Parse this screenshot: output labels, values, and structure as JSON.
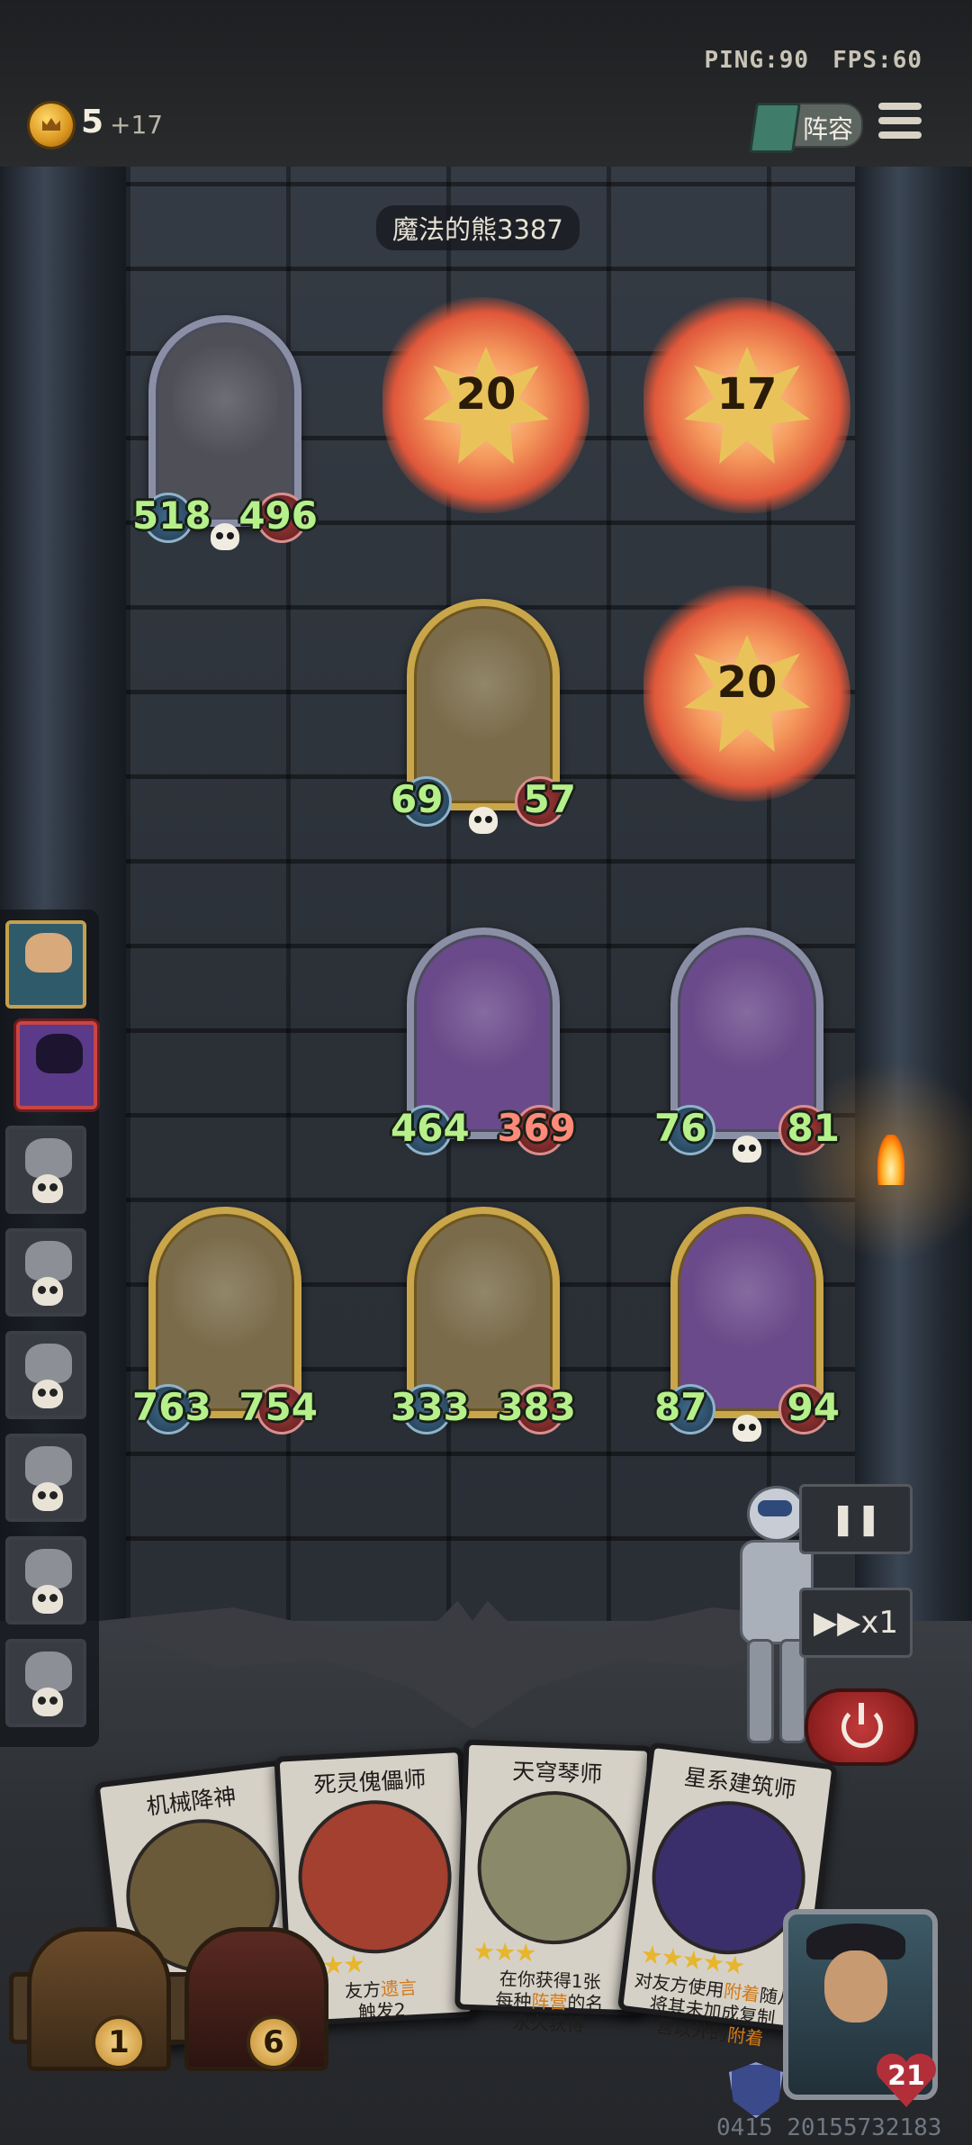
{
  "status": {
    "ping": "PING:90",
    "fps": "FPS:60"
  },
  "economy": {
    "gold": "5",
    "gold_income": "+17"
  },
  "header": {
    "lineup_label": "阵容"
  },
  "opponent": {
    "name": "魔法的熊3387"
  },
  "impacts": [
    {
      "damage": "20"
    },
    {
      "damage": "17"
    },
    {
      "damage": "20"
    }
  ],
  "units": [
    {
      "atk": "518",
      "hp": "496"
    },
    {
      "atk": "69",
      "hp": "57"
    },
    {
      "atk": "464",
      "hp": "369"
    },
    {
      "atk": "76",
      "hp": "81"
    },
    {
      "atk": "763",
      "hp": "754"
    },
    {
      "atk": "333",
      "hp": "383"
    },
    {
      "atk": "87",
      "hp": "94"
    }
  ],
  "controls": {
    "speed_label": "▶▶x1",
    "pause_icon": "pause-icon",
    "exit_icon": "power-icon"
  },
  "hand_cards": [
    {
      "title": "机械降神",
      "stars": "",
      "desc": ""
    },
    {
      "title": "死灵傀儡师",
      "stars": "★★★",
      "desc_a": "友方",
      "desc_hl": "遗言",
      "desc_b": "触发2"
    },
    {
      "title": "天穹琴师",
      "stars": "★★★",
      "desc_a": "在你获得1张",
      "desc_b": "每种",
      "desc_hl": "阵营",
      "desc_c": "的名",
      "desc_d": "永久获得"
    },
    {
      "title": "星系建筑师",
      "stars": "★★★★★",
      "desc_a": "对友方使用",
      "desc_hl": "附着",
      "desc_b": "随从",
      "desc_c": "将其未加成复制",
      "desc_d": "营以外的",
      "desc_hl2": "附着"
    }
  ],
  "shop": {
    "tier_1": "1",
    "tier_2": "6"
  },
  "hero": {
    "health": "21"
  },
  "footer": {
    "seed": "0415 20155732183"
  }
}
